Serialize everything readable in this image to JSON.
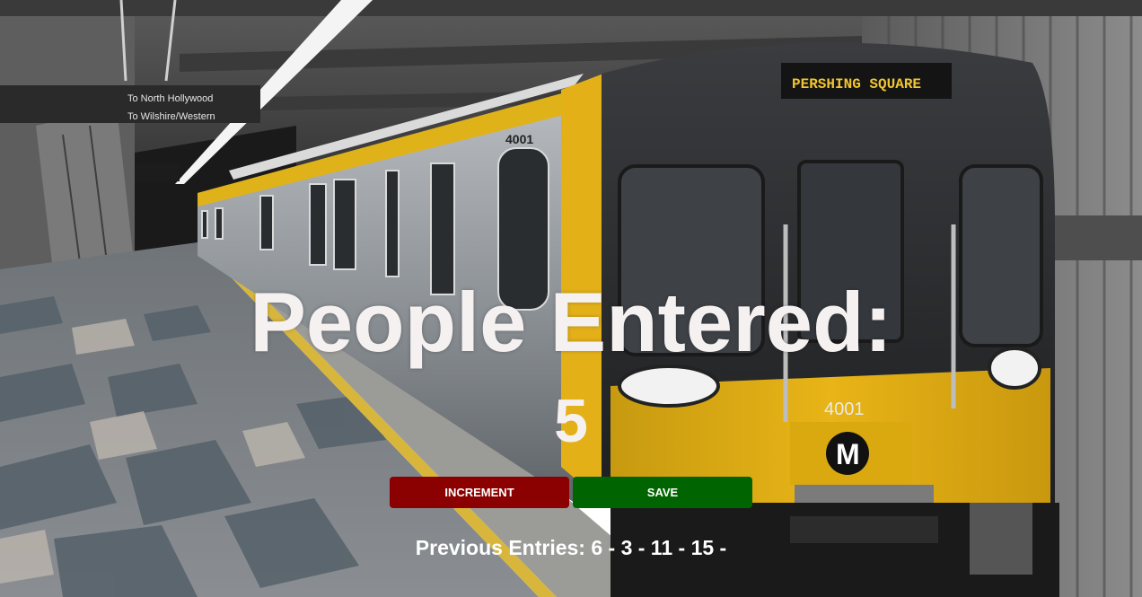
{
  "heading": "People Entered:",
  "count": "5",
  "buttons": {
    "increment_label": "INCREMENT",
    "save_label": "SAVE"
  },
  "previous_entries": "Previous Entries: 6 - 3 - 11 - 15 -",
  "background": {
    "signs": [
      "To North Hollywood",
      "To Wilshire/Western"
    ],
    "train_destination": "PERSHING SQUARE",
    "train_number": "4001",
    "metro_logo_letter": "M"
  },
  "colors": {
    "increment_button": "#8b0000",
    "save_button": "#006400",
    "text": "#ffffff",
    "train_yellow": "#e8b417"
  }
}
